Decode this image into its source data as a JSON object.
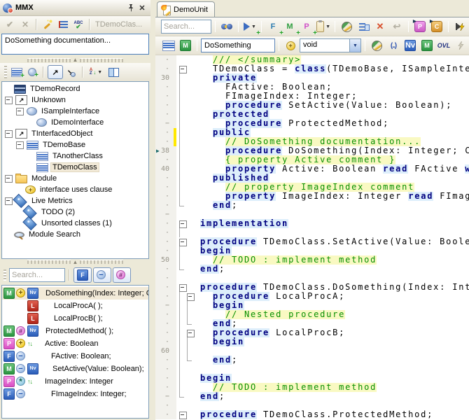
{
  "colors": {
    "selection": "#f2ead8",
    "keyword": "#000080",
    "keyword_bg": "#ddeefb",
    "comment": "#089000",
    "comment_bg": "#f9f9c2",
    "modified_marker": "#ffe800",
    "panel": "#ece9d8"
  },
  "left_panel": {
    "title": "MMX",
    "toolbar": {
      "target_label": "TDemoClas..."
    },
    "doc_memo": "DoSomething documentation...",
    "tree": {
      "items": [
        {
          "label": "TDemoRecord",
          "icon": "record",
          "level": 0,
          "exp": false
        },
        {
          "label": "IUnknown",
          "icon": "arrow",
          "level": 0,
          "exp": true
        },
        {
          "label": "ISampleInterface",
          "icon": "sphere",
          "level": 1,
          "exp": true
        },
        {
          "label": "IDemoInterface",
          "icon": "sphere",
          "level": 2,
          "exp": false
        },
        {
          "label": "TInterfacedObject",
          "icon": "arrow",
          "level": 0,
          "exp": true
        },
        {
          "label": "TDemoBase",
          "icon": "class",
          "level": 1,
          "exp": true
        },
        {
          "label": "TAnotherClass",
          "icon": "class",
          "level": 2,
          "exp": false
        },
        {
          "label": "TDemoClass",
          "icon": "class",
          "level": 2,
          "exp": false,
          "selected": true
        },
        {
          "label": "Module",
          "icon": "folder",
          "level": 0,
          "exp": true
        },
        {
          "label": "interface uses clause",
          "icon": "uses",
          "level": 1,
          "exp": false
        },
        {
          "label": "Live Metrics",
          "icon": "metric",
          "level": 0,
          "exp": true
        },
        {
          "label": "TODO (2)",
          "icon": "metric",
          "level": 1,
          "exp": false
        },
        {
          "label": "Unsorted classes (1)",
          "icon": "metric",
          "level": 1,
          "exp": false
        },
        {
          "label": "Module Search",
          "icon": "msearch",
          "level": 0,
          "exp": false
        }
      ]
    },
    "member_search_placeholder": "Search...",
    "members": [
      {
        "icons": [
          "method",
          "public",
          "nv"
        ],
        "label": "DoSomething(Index: Integer; Co",
        "selected": true,
        "indent": 0,
        "text_x": 58
      },
      {
        "icons": [
          "local"
        ],
        "label": "LocalProcA( );",
        "indent": 34,
        "text_x": 72
      },
      {
        "icons": [
          "local"
        ],
        "label": "LocalProcB( );",
        "indent": 34,
        "text_x": 72
      },
      {
        "icons": [
          "method",
          "protected",
          "nv"
        ],
        "label": "ProtectedMethod( );",
        "indent": 0,
        "text_x": 58
      },
      {
        "icons": [
          "property",
          "public",
          "rw"
        ],
        "label": "Active: Boolean",
        "indent": 0,
        "text_x": 58
      },
      {
        "icons": [
          "field",
          "private"
        ],
        "label": "FActive: Boolean;",
        "indent": 0,
        "text_x": 68
      },
      {
        "icons": [
          "method",
          "private",
          "nv"
        ],
        "label": "SetActive(Value: Boolean);",
        "indent": 0,
        "text_x": 68
      },
      {
        "icons": [
          "property",
          "published",
          "rw"
        ],
        "label": "ImageIndex: Integer",
        "indent": 0,
        "text_x": 58
      },
      {
        "icons": [
          "field",
          "private"
        ],
        "label": "FImageIndex: Integer;",
        "indent": 0,
        "text_x": 68
      }
    ]
  },
  "editor": {
    "tab": "DemoUnit",
    "toolbar1": {
      "search_placeholder": "Search..."
    },
    "toolbar2": {
      "member_name": "DoSomething",
      "result_type": "void",
      "ovl_label": "OVL",
      "params_label": "(..)"
    },
    "code": {
      "current_line": 38,
      "modified_lines": [
        36,
        37
      ],
      "lines": [
        {
          "n": 28,
          "f": [
            "",
            ""
          ],
          "s": [
            [
              "t",
              "  "
            ],
            [
              "c",
              "/// </summary>"
            ]
          ]
        },
        {
          "n": 29,
          "f": [
            "box",
            ""
          ],
          "s": [
            [
              "t",
              "  TDemoClass = "
            ],
            [
              "k",
              "class"
            ],
            [
              "t",
              "(TDemoBase, ISampleInte"
            ]
          ]
        },
        {
          "n": 30,
          "f": [
            "line",
            ""
          ],
          "s": [
            [
              "t",
              "  "
            ],
            [
              "k",
              "private"
            ]
          ]
        },
        {
          "n": 31,
          "f": [
            "line",
            ""
          ],
          "s": [
            [
              "t",
              "    FActive: Boolean;"
            ]
          ]
        },
        {
          "n": 32,
          "f": [
            "line",
            ""
          ],
          "s": [
            [
              "t",
              "    FImageIndex: Integer;"
            ]
          ]
        },
        {
          "n": 33,
          "f": [
            "line",
            ""
          ],
          "s": [
            [
              "t",
              "    "
            ],
            [
              "k",
              "procedure"
            ],
            [
              "t",
              " SetActive(Value: Boolean);"
            ]
          ]
        },
        {
          "n": 34,
          "f": [
            "line",
            ""
          ],
          "s": [
            [
              "t",
              "  "
            ],
            [
              "k",
              "protected"
            ]
          ]
        },
        {
          "n": 35,
          "f": [
            "line",
            ""
          ],
          "s": [
            [
              "t",
              "    "
            ],
            [
              "k",
              "procedure"
            ],
            [
              "t",
              " ProtectedMethod;"
            ]
          ]
        },
        {
          "n": 36,
          "f": [
            "line",
            ""
          ],
          "s": [
            [
              "t",
              "  "
            ],
            [
              "k",
              "public"
            ]
          ]
        },
        {
          "n": 37,
          "f": [
            "line",
            ""
          ],
          "s": [
            [
              "t",
              "    "
            ],
            [
              "c",
              "// DoSomething documentation..."
            ]
          ]
        },
        {
          "n": 38,
          "f": [
            "line",
            ""
          ],
          "s": [
            [
              "t",
              "    "
            ],
            [
              "k",
              "procedure"
            ],
            [
              "t",
              " DoSomething(Index: Integer; C"
            ]
          ]
        },
        {
          "n": 39,
          "f": [
            "line",
            ""
          ],
          "s": [
            [
              "t",
              "    "
            ],
            [
              "c",
              "{ property Active comment }"
            ]
          ]
        },
        {
          "n": 40,
          "f": [
            "line",
            ""
          ],
          "s": [
            [
              "t",
              "    "
            ],
            [
              "k",
              "property"
            ],
            [
              "t",
              " Active: Boolean "
            ],
            [
              "k",
              "read"
            ],
            [
              "t",
              " FActive "
            ],
            [
              "k",
              "w"
            ]
          ]
        },
        {
          "n": 41,
          "f": [
            "line",
            ""
          ],
          "s": [
            [
              "t",
              "  "
            ],
            [
              "k",
              "published"
            ]
          ]
        },
        {
          "n": 42,
          "f": [
            "line",
            ""
          ],
          "s": [
            [
              "t",
              "    "
            ],
            [
              "c",
              "// property ImageIndex comment"
            ]
          ]
        },
        {
          "n": 43,
          "f": [
            "line",
            ""
          ],
          "s": [
            [
              "t",
              "    "
            ],
            [
              "k",
              "property"
            ],
            [
              "t",
              " ImageIndex: Integer "
            ],
            [
              "k",
              "read"
            ],
            [
              "t",
              " FImag"
            ]
          ]
        },
        {
          "n": 44,
          "f": [
            "corner",
            ""
          ],
          "s": [
            [
              "t",
              "  "
            ],
            [
              "k",
              "end"
            ],
            [
              "t",
              ";"
            ]
          ]
        },
        {
          "n": 45,
          "f": [
            "",
            ""
          ],
          "s": []
        },
        {
          "n": 46,
          "f": [
            "box",
            ""
          ],
          "s": [
            [
              "k",
              "implementation"
            ]
          ]
        },
        {
          "n": 47,
          "f": [
            "line",
            ""
          ],
          "s": []
        },
        {
          "n": 48,
          "f": [
            "box",
            ""
          ],
          "s": [
            [
              "k",
              "procedure"
            ],
            [
              "t",
              " TDemoClass.SetActive(Value: Boole"
            ]
          ]
        },
        {
          "n": 49,
          "f": [
            "line",
            ""
          ],
          "s": [
            [
              "k",
              "begin"
            ]
          ]
        },
        {
          "n": 50,
          "f": [
            "line",
            ""
          ],
          "s": [
            [
              "t",
              "  "
            ],
            [
              "c",
              "// TODO : implement method"
            ]
          ]
        },
        {
          "n": 51,
          "f": [
            "corner",
            ""
          ],
          "s": [
            [
              "k",
              "end"
            ],
            [
              "t",
              ";"
            ]
          ]
        },
        {
          "n": 52,
          "f": [
            "",
            ""
          ],
          "s": []
        },
        {
          "n": 53,
          "f": [
            "box",
            ""
          ],
          "s": [
            [
              "k",
              "procedure"
            ],
            [
              "t",
              " TDemoClass.DoSomething(Index: Int"
            ]
          ]
        },
        {
          "n": 54,
          "f": [
            "line",
            "box"
          ],
          "s": [
            [
              "t",
              "  "
            ],
            [
              "k",
              "procedure"
            ],
            [
              "t",
              " LocalProcA;"
            ]
          ]
        },
        {
          "n": 55,
          "f": [
            "line",
            "line"
          ],
          "s": [
            [
              "t",
              "  "
            ],
            [
              "k",
              "begin"
            ]
          ]
        },
        {
          "n": 56,
          "f": [
            "line",
            "line"
          ],
          "s": [
            [
              "t",
              "    "
            ],
            [
              "c",
              "// Nested procedure"
            ]
          ]
        },
        {
          "n": 57,
          "f": [
            "line",
            "corner"
          ],
          "s": [
            [
              "t",
              "  "
            ],
            [
              "k",
              "end"
            ],
            [
              "t",
              ";"
            ]
          ]
        },
        {
          "n": 58,
          "f": [
            "line",
            "box"
          ],
          "s": [
            [
              "t",
              "  "
            ],
            [
              "k",
              "procedure"
            ],
            [
              "t",
              " LocalProcB;"
            ]
          ]
        },
        {
          "n": 59,
          "f": [
            "line",
            "line"
          ],
          "s": [
            [
              "t",
              "  "
            ],
            [
              "k",
              "begin"
            ]
          ]
        },
        {
          "n": 60,
          "f": [
            "line",
            "line"
          ],
          "s": []
        },
        {
          "n": 61,
          "f": [
            "line",
            "corner"
          ],
          "s": [
            [
              "t",
              "  "
            ],
            [
              "k",
              "end"
            ],
            [
              "t",
              ";"
            ]
          ]
        },
        {
          "n": 62,
          "f": [
            "line",
            ""
          ],
          "s": []
        },
        {
          "n": 63,
          "f": [
            "line",
            ""
          ],
          "s": [
            [
              "k",
              "begin"
            ]
          ]
        },
        {
          "n": 64,
          "f": [
            "line",
            ""
          ],
          "s": [
            [
              "t",
              "  "
            ],
            [
              "c",
              "// TODO : implement method"
            ]
          ]
        },
        {
          "n": 65,
          "f": [
            "corner",
            ""
          ],
          "s": [
            [
              "k",
              "end"
            ],
            [
              "t",
              ";"
            ]
          ]
        },
        {
          "n": 66,
          "f": [
            "",
            ""
          ],
          "s": []
        },
        {
          "n": 67,
          "f": [
            "box",
            ""
          ],
          "s": [
            [
              "k",
              "procedure"
            ],
            [
              "t",
              " TDemoClass.ProtectedMethod;"
            ]
          ]
        }
      ]
    }
  }
}
